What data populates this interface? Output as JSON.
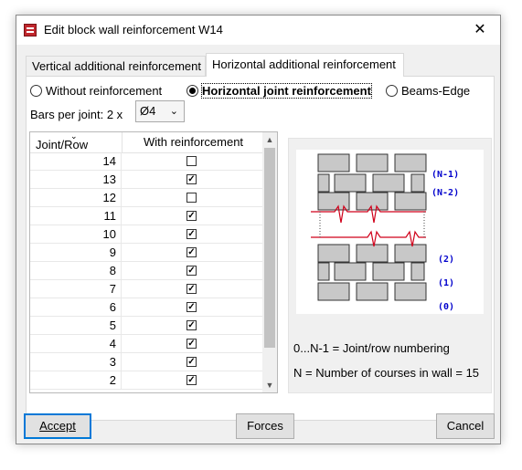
{
  "window": {
    "title": "Edit block wall reinforcement W14",
    "close_symbol": "✕",
    "app_icon": "app-icon"
  },
  "tabs": [
    {
      "label": "Vertical additional reinforcement",
      "active": false
    },
    {
      "label": "Horizontal additional reinforcement",
      "active": true
    }
  ],
  "reinforcement_options": [
    {
      "label": "Without reinforcement",
      "selected": false
    },
    {
      "label": "Horizontal joint reinforcement",
      "selected": true
    },
    {
      "label": "Beams-Edge",
      "selected": false
    }
  ],
  "bars": {
    "label": "Bars per joint:  2 x",
    "value": "Ø4"
  },
  "table": {
    "columns": [
      "Joint/Row",
      "With reinforcement"
    ],
    "rows": [
      {
        "joint": "14",
        "checked": false
      },
      {
        "joint": "13",
        "checked": true
      },
      {
        "joint": "12",
        "checked": false
      },
      {
        "joint": "11",
        "checked": true
      },
      {
        "joint": "10",
        "checked": true
      },
      {
        "joint": "9",
        "checked": true
      },
      {
        "joint": "8",
        "checked": true
      },
      {
        "joint": "7",
        "checked": true
      },
      {
        "joint": "6",
        "checked": true
      },
      {
        "joint": "5",
        "checked": true
      },
      {
        "joint": "4",
        "checked": true
      },
      {
        "joint": "3",
        "checked": true
      },
      {
        "joint": "2",
        "checked": true
      }
    ]
  },
  "diagram": {
    "labels_top": [
      "(N-1)",
      "(N-2)"
    ],
    "labels_bottom": [
      "(2)",
      "(1)",
      "(0)"
    ],
    "brick_color": "#c8c8c8",
    "joint_line_color": "#d0021b",
    "label_color": "#0000cc"
  },
  "info": {
    "numbering": "0...N-1 = Joint/row numbering",
    "courses": "N = Number of courses in wall = 15"
  },
  "buttons": {
    "accept": "Accept",
    "forces": "Forces",
    "cancel": "Cancel"
  }
}
